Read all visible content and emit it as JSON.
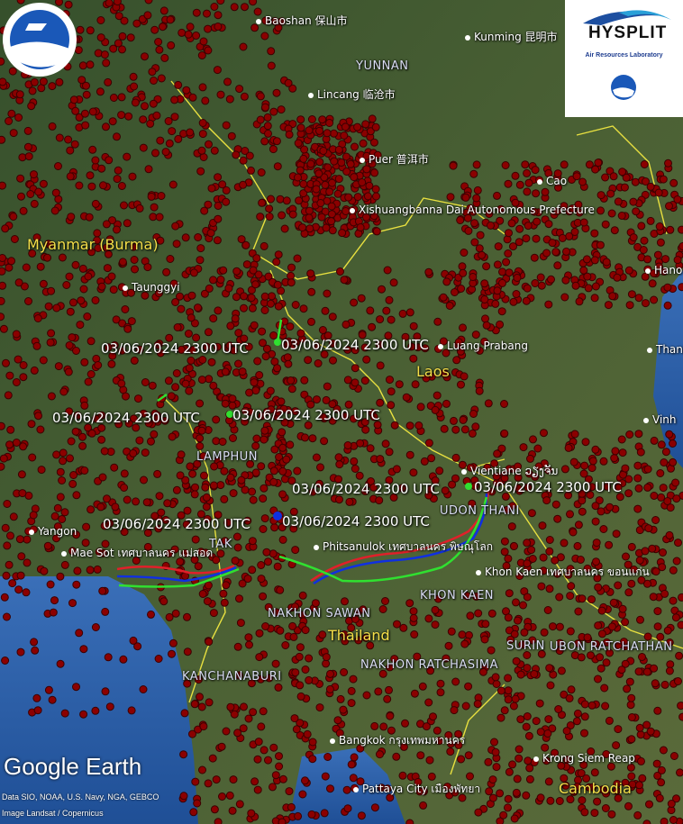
{
  "map": {
    "country_labels": [
      "Myanmar (Burma)",
      "Laos",
      "Thailand",
      "Cambodia"
    ],
    "province_labels": [
      "YUNNAN",
      "LAMPHUN",
      "TAK",
      "UDON THANI",
      "NAKHON SAWAN",
      "KHON KAEN",
      "NAKHON RATCHASIMA",
      "KANCHANABURI",
      "SURIN",
      "UBON RATCHATHAN"
    ],
    "city_labels": [
      "Baoshan 保山市",
      "Kunming 昆明市",
      "Lincang 临沧市",
      "Puer 普洱市",
      "Xishuangbanna Dai Autonomous Prefecture",
      "Taunggyi",
      "Luang Prabang",
      "Vientiane ວຽງຈັນ",
      "Phitsanulok เทศบาลนคร พิษณุโลก",
      "Khon Kaen เทศบาลนคร ขอนแก่น",
      "Yangon",
      "Mae Sot เทศบาลนคร แม่สอด",
      "Bangkok กรุงเทพมหานคร",
      "Pattaya City เมืองพัทยา",
      "Krong Siem Reap",
      "Hano",
      "Thanh",
      "Vinh",
      "Cao"
    ],
    "trajectory_labels": [
      "03/06/2024 2300 UTC",
      "03/06/2024 2300 UTC",
      "03/06/2024 2300 UTC",
      "03/06/2024 2300 UTC",
      "03/06/2024 2300 UTC",
      "03/06/2024 2300 UTC",
      "03/06/2024 2300 UTC",
      "03/06/2024 2300 UTC"
    ]
  },
  "branding": {
    "hysplit_title": "HYSPLIT",
    "hysplit_sub": "Air Resources Laboratory",
    "ge_logo": "Google Earth",
    "credit1": "Data SIO, NOAA, U.S. Navy, NGA, GEBCO",
    "credit2": "Image Landsat / Copernicus"
  },
  "colors": {
    "fire": "#8b0000",
    "traj_red": "#e0202a",
    "traj_blue": "#1030e0",
    "traj_green": "#30e030",
    "border": "#e8e040"
  }
}
